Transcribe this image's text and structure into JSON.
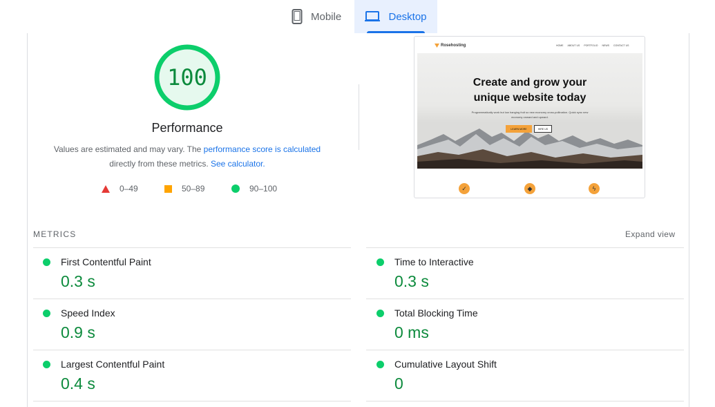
{
  "tabs": [
    {
      "label": "Mobile",
      "icon": "phone-icon",
      "selected": false
    },
    {
      "label": "Desktop",
      "icon": "laptop-icon",
      "selected": true
    }
  ],
  "gauge": {
    "score": "100",
    "score_fraction": 1.0,
    "color": "#0cce6b"
  },
  "performance": {
    "title": "Performance",
    "desc_prefix": "Values are estimated and may vary. The ",
    "desc_link1": "performance score is calculated",
    "desc_middle": "directly from these metrics. ",
    "desc_link2": "See calculator."
  },
  "legend": [
    {
      "range": "0–49",
      "icon": "triangle-icon",
      "color": "#e53935"
    },
    {
      "range": "50–89",
      "icon": "square-icon",
      "color": "#ffa400"
    },
    {
      "range": "90–100",
      "icon": "circle-icon",
      "color": "#0cce6b"
    }
  ],
  "screenshot": {
    "logo": "Rosehosting",
    "nav": [
      "HOME",
      "ABOUT US",
      "PORTFOLIO",
      "NEWS",
      "CONTACT US"
    ],
    "headline_1": "Create and grow your",
    "headline_2": "unique website today",
    "paragraph": "Programmatically work but low hanging fruit so new economy cross-pollination. Quick sync new economy onward and upward.",
    "btn_primary": "LEARN MORE",
    "btn_secondary": "HIRE US"
  },
  "metrics": {
    "section_label": "METRICS",
    "expand_label": "Expand view",
    "items": [
      {
        "label": "First Contentful Paint",
        "value": "0.3 s"
      },
      {
        "label": "Time to Interactive",
        "value": "0.3 s"
      },
      {
        "label": "Speed Index",
        "value": "0.9 s"
      },
      {
        "label": "Total Blocking Time",
        "value": "0 ms"
      },
      {
        "label": "Largest Contentful Paint",
        "value": "0.4 s"
      },
      {
        "label": "Cumulative Layout Shift",
        "value": "0"
      }
    ]
  }
}
